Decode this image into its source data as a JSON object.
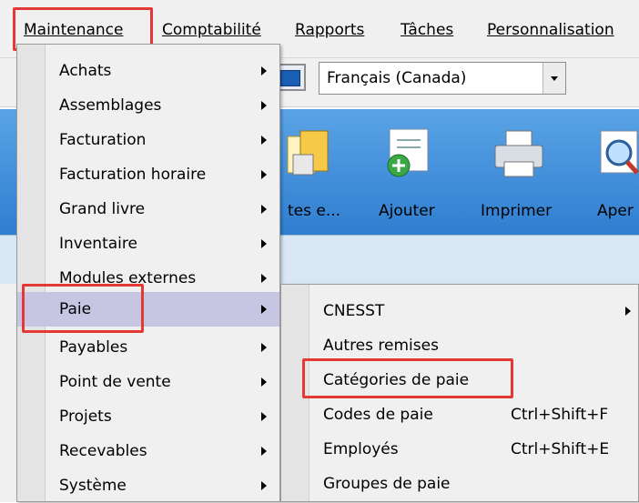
{
  "menubar": {
    "items": [
      "Maintenance",
      "Comptabilité",
      "Rapports",
      "Tâches",
      "Personnalisation"
    ]
  },
  "toolbar": {
    "language": "Français (Canada)"
  },
  "ribbon": {
    "buttons": [
      "tes e...",
      "Ajouter",
      "Imprimer",
      "Aper"
    ]
  },
  "maintenance_menu": {
    "items": [
      {
        "label": "Achats"
      },
      {
        "label": "Assemblages"
      },
      {
        "label": "Facturation"
      },
      {
        "label": "Facturation horaire"
      },
      {
        "label": "Grand livre"
      },
      {
        "label": "Inventaire"
      },
      {
        "label": "Modules externes"
      },
      {
        "label": "Paie"
      },
      {
        "label": "Payables"
      },
      {
        "label": "Point de vente"
      },
      {
        "label": "Projets"
      },
      {
        "label": "Recevables"
      },
      {
        "label": "Système"
      }
    ]
  },
  "paie_submenu": {
    "items": [
      {
        "label": "CNESST",
        "shortcut": ""
      },
      {
        "label": "Autres remises",
        "shortcut": ""
      },
      {
        "label": "Catégories de paie",
        "shortcut": ""
      },
      {
        "label": "Codes de paie",
        "shortcut": "Ctrl+Shift+F"
      },
      {
        "label": "Employés",
        "shortcut": "Ctrl+Shift+E"
      },
      {
        "label": "Groupes de paie",
        "shortcut": ""
      }
    ]
  },
  "colors": {
    "highlight_box": "#e53935",
    "ribbon": "#2f7ed0",
    "menu_bg": "#f0f0f0",
    "active_item": "#c6c6e2"
  }
}
